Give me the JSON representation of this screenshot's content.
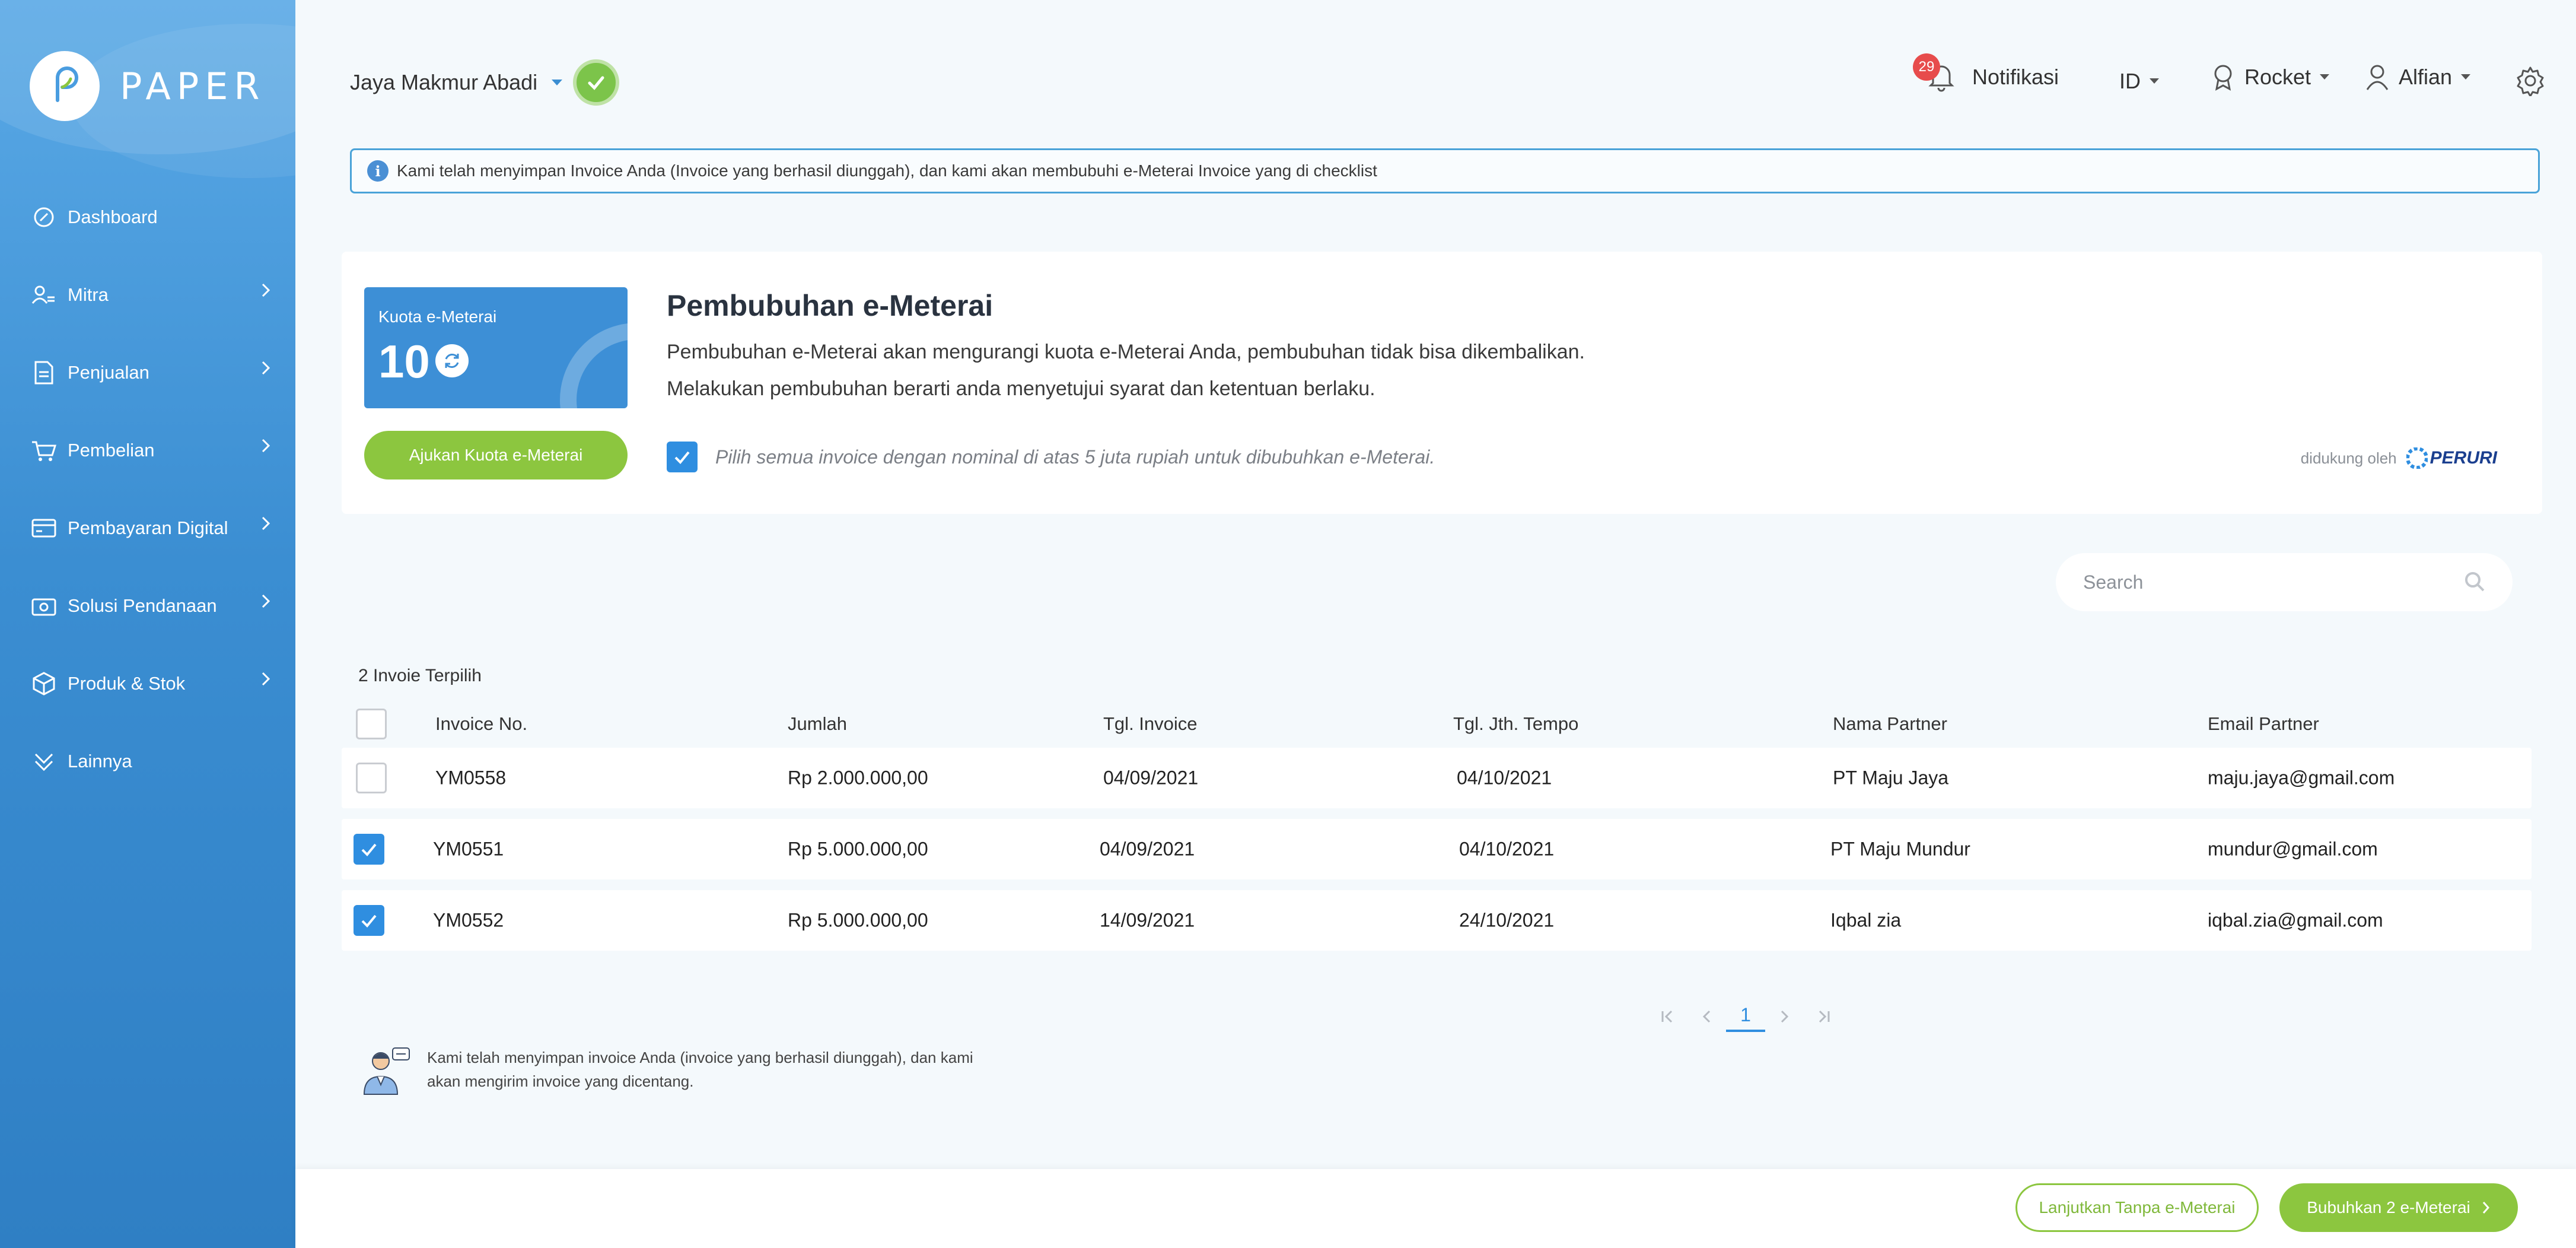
{
  "app": {
    "logo_text": "PAPER"
  },
  "sidebar": {
    "items": [
      {
        "label": "Dashboard",
        "icon": "dashboard-icon",
        "has_submenu": false
      },
      {
        "label": "Mitra",
        "icon": "partners-icon",
        "has_submenu": true
      },
      {
        "label": "Penjualan",
        "icon": "document-icon",
        "has_submenu": true
      },
      {
        "label": "Pembelian",
        "icon": "cart-icon",
        "has_submenu": true
      },
      {
        "label": "Pembayaran Digital",
        "icon": "card-icon",
        "has_submenu": true
      },
      {
        "label": "Solusi Pendanaan",
        "icon": "funding-icon",
        "has_submenu": true
      },
      {
        "label": "Produk & Stok",
        "icon": "box-icon",
        "has_submenu": true
      },
      {
        "label": "Lainnya",
        "icon": "more-icon",
        "has_submenu": false
      }
    ]
  },
  "header": {
    "company": "Jaya Makmur Abadi",
    "notif_count": "29",
    "notif_label": "Notifikasi",
    "language": "ID",
    "plan": "Rocket",
    "user": "Alfian"
  },
  "info_banner": "Kami telah menyimpan Invoice Anda (Invoice yang berhasil diunggah), dan kami akan membubuhi e-Meterai Invoice yang di checklist",
  "emeterai": {
    "quota_title": "Kuota e-Meterai",
    "quota_value": "10",
    "request_button": "Ajukan Kuota e-Meterai",
    "title": "Pembubuhan e-Meterai",
    "desc1": "Pembubuhan e-Meterai akan mengurangi kuota e-Meterai Anda, pembubuhan tidak bisa dikembalikan.",
    "desc2": "Melakukan pembubuhan berarti anda menyetujui syarat dan ketentuan berlaku.",
    "select_all_label": "Pilih semua invoice dengan nominal di atas 5 juta rupiah untuk dibubuhkan e-Meterai.",
    "supported_by": "didukung oleh",
    "partner_logo": "PERURI"
  },
  "search": {
    "placeholder": "Search"
  },
  "table": {
    "selected_count": "2 Invoie Terpilih",
    "columns": [
      "Invoice No.",
      "Jumlah",
      "Tgl. Invoice",
      "Tgl. Jth. Tempo",
      "Nama Partner",
      "Email Partner"
    ],
    "rows": [
      {
        "checked": false,
        "invoice_no": "YM0558",
        "amount": "Rp 2.000.000,00",
        "invoice_date": "04/09/2021",
        "due_date": "04/10/2021",
        "partner": "PT Maju Jaya",
        "email": "maju.jaya@gmail.com"
      },
      {
        "checked": true,
        "invoice_no": "YM0551",
        "amount": "Rp 5.000.000,00",
        "invoice_date": "04/09/2021",
        "due_date": "04/10/2021",
        "partner": "PT Maju Mundur",
        "email": "mundur@gmail.com"
      },
      {
        "checked": true,
        "invoice_no": "YM0552",
        "amount": "Rp 5.000.000,00",
        "invoice_date": "14/09/2021",
        "due_date": "24/10/2021",
        "partner": "Iqbal zia",
        "email": "iqbal.zia@gmail.com"
      }
    ]
  },
  "pagination": {
    "current_page": "1"
  },
  "footnote": "Kami telah menyimpan invoice Anda (invoice yang berhasil diunggah), dan kami akan mengirim invoice yang dicentang.",
  "actions": {
    "skip_label": "Lanjutkan Tanpa e-Meterai",
    "apply_label": "Bubuhkan 2 e-Meterai"
  },
  "colors": {
    "sidebar_blue": "#3b8ed2",
    "accent_blue": "#2f8ee0",
    "green": "#8cc63f",
    "badge_red": "#e74c4c"
  }
}
